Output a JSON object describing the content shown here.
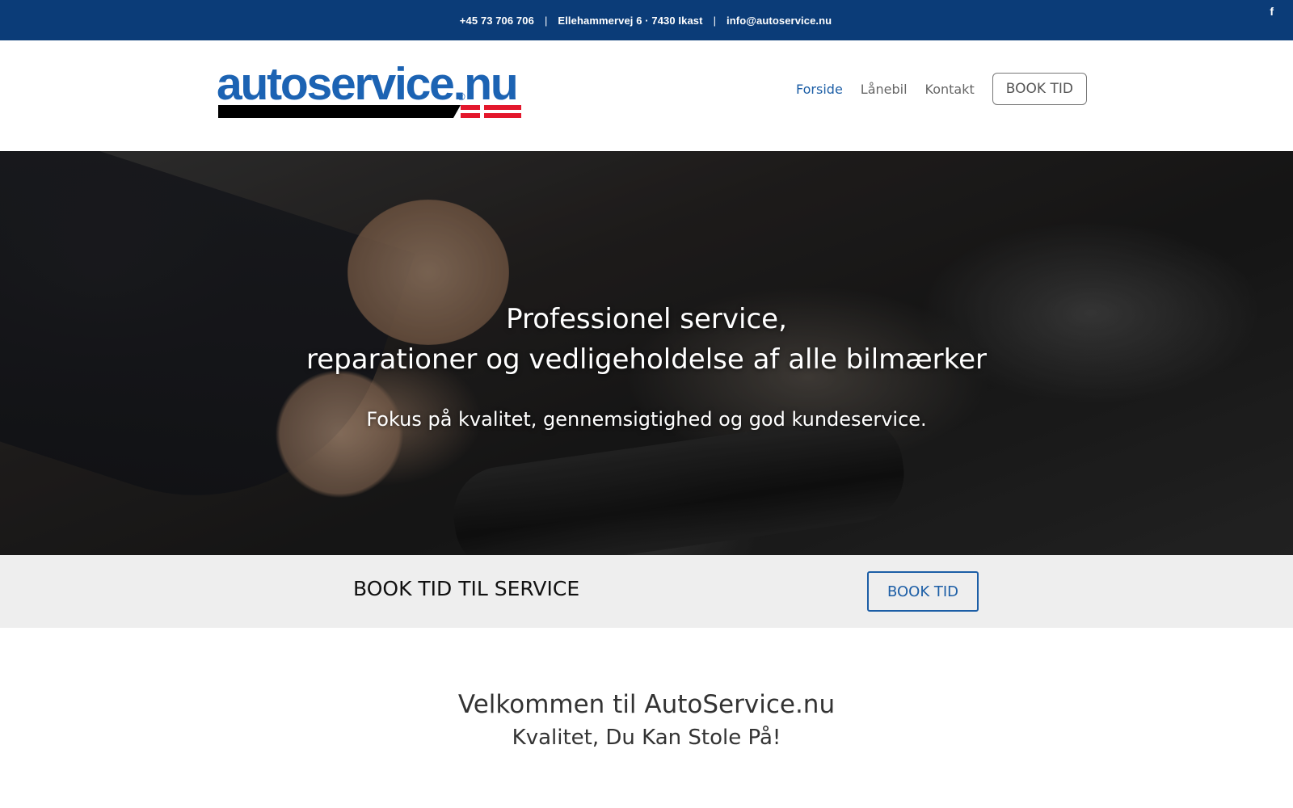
{
  "topbar": {
    "phone": "+45 73 706 706",
    "address": "Ellehammervej 6 · 7430 Ikast",
    "email": "info@autoservice.nu",
    "separator": "|",
    "facebook_icon": "f",
    "background_color": "#0b3c78"
  },
  "header": {
    "logo_text": "autoservice.nu",
    "logo_registered": "®",
    "nav": {
      "items": [
        {
          "label": "Forside",
          "active": true
        },
        {
          "label": "Lånebil",
          "active": false
        },
        {
          "label": "Kontakt",
          "active": false
        }
      ],
      "book_button": "BOOK TID"
    }
  },
  "hero": {
    "title_line1": "Professionel service,",
    "title_line2": "reparationer og vedligeholdelse af alle bilmærker",
    "subtitle": "Fokus på kvalitet, gennemsigtighed og god kundeservice."
  },
  "book_strip": {
    "title": "BOOK TID TIL SERVICE",
    "button": "BOOK TID"
  },
  "welcome": {
    "title": "Velkommen til AutoService.nu",
    "subtitle": "Kvalitet, Du Kan Stole På!"
  },
  "colors": {
    "brand_blue": "#1c63b3",
    "accent_red": "#e3172c",
    "nav_active": "#1c5ea6"
  }
}
